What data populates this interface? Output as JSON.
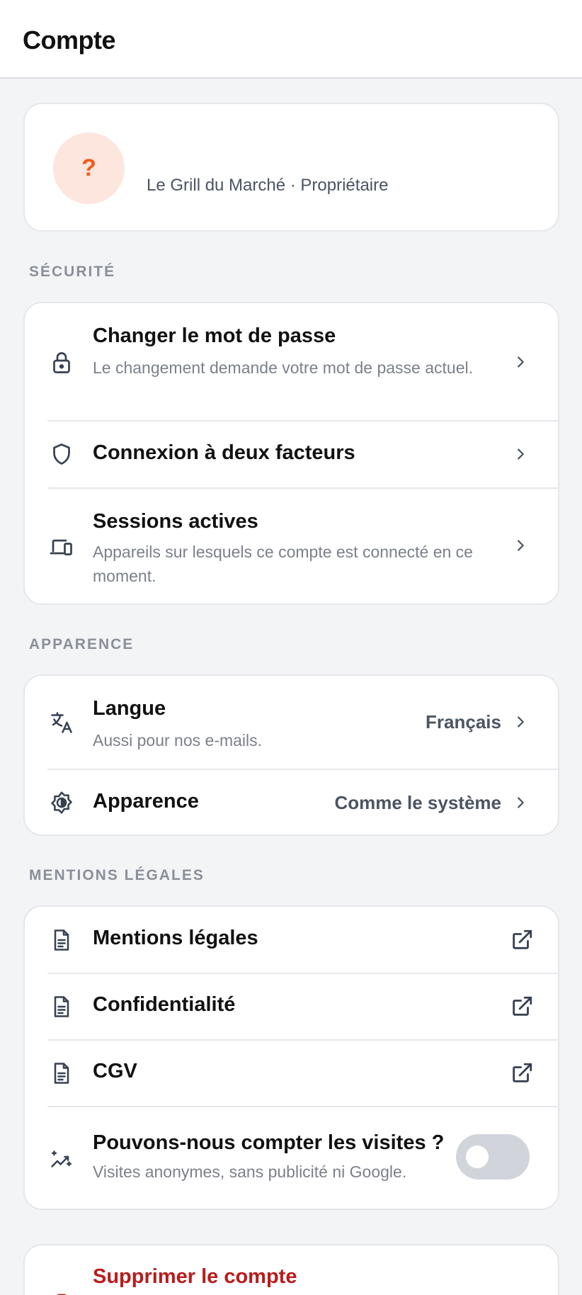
{
  "header": {
    "title": "Compte"
  },
  "profile": {
    "avatar_glyph": "?",
    "subtitle": "Le Grill du Marché · Propriétaire"
  },
  "security": {
    "label": "SÉCURITÉ",
    "items": [
      {
        "title": "Changer le mot de passe",
        "subtitle": "Le changement demande votre mot de passe actuel.",
        "icon": "lock-icon"
      },
      {
        "title": "Connexion à deux facteurs",
        "icon": "shield-icon"
      },
      {
        "title": "Sessions actives",
        "subtitle": "Appareils sur lesquels ce compte est connecté en ce moment.",
        "icon": "devices-icon"
      }
    ]
  },
  "appearance": {
    "label": "APPARENCE",
    "items": [
      {
        "title": "Langue",
        "subtitle": "Aussi pour nos e-mails.",
        "value": "Français",
        "icon": "translate-icon"
      },
      {
        "title": "Apparence",
        "value": "Comme le système",
        "icon": "brightness-icon"
      }
    ]
  },
  "legal": {
    "label": "MENTIONS LÉGALES",
    "items": [
      {
        "title": "Mentions légales",
        "icon": "document-icon"
      },
      {
        "title": "Confidentialité",
        "icon": "document-icon"
      },
      {
        "title": "CGV",
        "icon": "document-icon"
      }
    ],
    "analytics": {
      "title": "Pouvons-nous compter les visites ?",
      "subtitle": "Visites anonymes, sans publicité ni Google.",
      "enabled": false,
      "icon": "analytics-sparkle-icon"
    }
  },
  "danger": {
    "delete_label": "Supprimer le compte"
  },
  "colors": {
    "accent": "#f25b1c",
    "avatar_bg": "#fde6dd",
    "danger": "#b91c1c",
    "toggle_off": "#d1d5db"
  }
}
